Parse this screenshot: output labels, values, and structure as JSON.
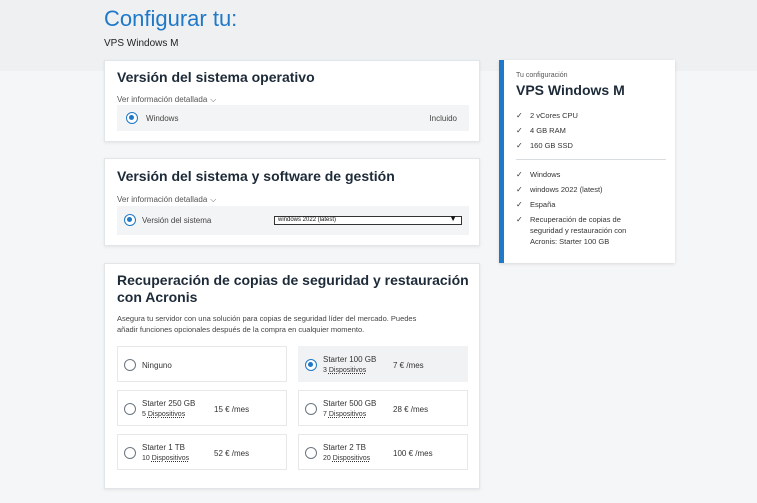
{
  "header": {
    "title": "Configurar tu:",
    "subtitle": "VPS Windows M"
  },
  "os_section": {
    "title": "Versión del sistema operativo",
    "details_link": "Ver información detallada",
    "option": {
      "label": "Windows",
      "status": "Incluido",
      "selected": true
    }
  },
  "software_section": {
    "title": "Versión del sistema y software de gestión",
    "details_link": "Ver información detallada",
    "option_label": "Versión del sistema",
    "select_value": "windows 2022 (latest)"
  },
  "backup_section": {
    "title_line1": "Recuperación de copias de seguridad y restauración",
    "title_line2": "con Acronis",
    "description_line1": "Asegura tu servidor con una solución para copias de seguridad líder del mercado. Puedes",
    "description_line2": "añadir funciones opcionales después de la compra en cualquier momento.",
    "devices_word": "Dispositivos",
    "options": [
      {
        "name": "Ninguno",
        "devices": "",
        "price": "",
        "selected": false
      },
      {
        "name": "Starter 100 GB",
        "devices": "3",
        "price": "7 € /mes",
        "selected": true
      },
      {
        "name": "Starter 250 GB",
        "devices": "5",
        "price": "15 € /mes",
        "selected": false
      },
      {
        "name": "Starter 500 GB",
        "devices": "7",
        "price": "28 € /mes",
        "selected": false
      },
      {
        "name": "Starter 1 TB",
        "devices": "10",
        "price": "52 € /mes",
        "selected": false
      },
      {
        "name": "Starter 2 TB",
        "devices": "20",
        "price": "100 € /mes",
        "selected": false
      }
    ]
  },
  "summary": {
    "label": "Tu configuración",
    "plan": "VPS Windows M",
    "specs": [
      "2 vCores CPU",
      "4 GB RAM",
      "160 GB SSD"
    ],
    "choices": [
      "Windows",
      "windows 2022 (latest)",
      "España"
    ],
    "backup_line1": "Recuperación de copias de",
    "backup_line2": "seguridad y restauración con",
    "backup_line3": "Acronis: Starter 100 GB",
    "accent_color": "#1f78c8"
  }
}
